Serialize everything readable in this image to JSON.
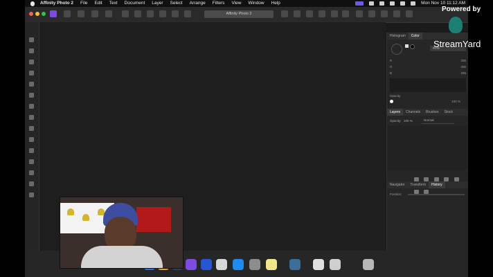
{
  "menubar": {
    "app_name": "Affinity Photo 2",
    "items": [
      "File",
      "Edit",
      "Text",
      "Document",
      "Layer",
      "Select",
      "Arrange",
      "Filters",
      "View",
      "Window",
      "Help"
    ],
    "clock": "Mon Nov 10  11:12 AM"
  },
  "toolbar": {
    "document_title": "Affinity Photo 2"
  },
  "color_panel": {
    "tabs": [
      "Histogram",
      "Color"
    ],
    "active_tab": "Color",
    "model": "RGB",
    "channels": [
      {
        "label": "R",
        "value": "255"
      },
      {
        "label": "G",
        "value": "255"
      },
      {
        "label": "B",
        "value": "255"
      }
    ],
    "opacity_label": "Opacity",
    "opacity_value": "100 %"
  },
  "layers_panel": {
    "tabs": [
      "Layers",
      "Channels",
      "Brushes",
      "Stock"
    ],
    "active_tab": "Layers",
    "opacity_label": "Opacity:",
    "opacity_value": "100 %",
    "blend_mode": "Normal"
  },
  "history_panel": {
    "tabs": [
      "Navigator",
      "Transform",
      "History"
    ],
    "active_tab": "History",
    "position_label": "Position:"
  },
  "watermark": {
    "powered_by": "Powered by",
    "brand": "StreamYard"
  },
  "colors": {
    "accent": "#7c4ce0",
    "close": "#ff5f57",
    "minimize": "#febc2e",
    "zoom": "#28c840"
  }
}
